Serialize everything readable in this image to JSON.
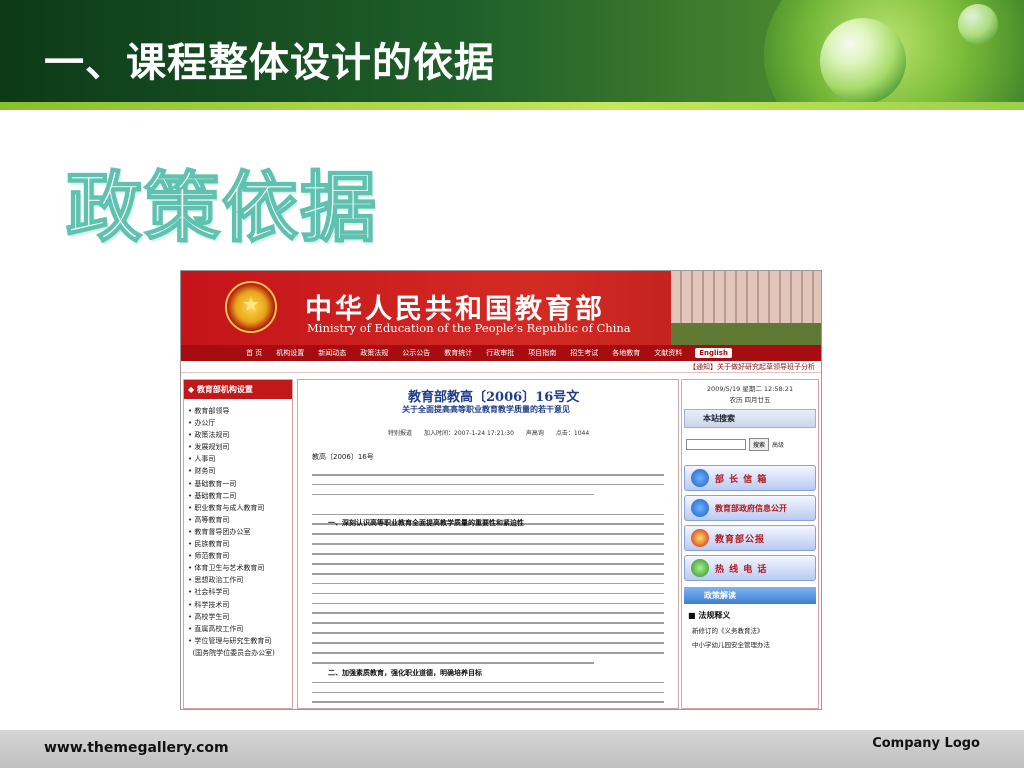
{
  "slide": {
    "title": "一、课程整体设计的依据",
    "subtitle": "政策依据"
  },
  "site": {
    "name_cn": "中华人民共和国教育部",
    "name_en": "Ministry of Education of the People’s Republic of China",
    "nav": [
      "首 页",
      "机构设置",
      "新闻动态",
      "政策法规",
      "公示公告",
      "教育统计",
      "行政审批",
      "项目指南",
      "招生考试",
      "各地教育",
      "文献资料"
    ],
    "english_button": "English",
    "notice": "【通知】关于做好研究起草领导班子分析"
  },
  "left_panel": {
    "heading": "◆ 教育部机构设置",
    "items": [
      "教育部领导",
      "办公厅",
      "政策法规司",
      "发展规划司",
      "人事司",
      "财务司",
      "基础教育一司",
      "基础教育二司",
      "职业教育与成人教育司",
      "高等教育司",
      "教育督导团办公室",
      "民族教育司",
      "师范教育司",
      "体育卫生与艺术教育司",
      "思想政治工作司",
      "社会科学司",
      "科学技术司",
      "高校学生司",
      "直属高校工作司",
      "学位管理与研究生教育司",
      "(国务院学位委员会办公室)"
    ]
  },
  "article": {
    "doc_number": "教育部教高〔2006〕16号文",
    "doc_title": "关于全面提高高等职业教育教学质量的若干意见",
    "meta": "特别报道　　加入时间：2007-1-24 17:21:30　　声高询　　点击：1044",
    "ref": "教高〔2006〕16号",
    "section1": "一、深刻认识高等职业教育全面提高教学质量的重要性和紧迫性",
    "section2": "二、加强素质教育，强化职业道德，明确培养目标"
  },
  "right_panel": {
    "datetime": "2009/5/19 星期二 12:58:21",
    "lunar": "农历 四月廿五",
    "search_title": "本站搜索",
    "search_button": "搜索",
    "advanced": "高级",
    "buttons": [
      "部 长 信 箱",
      "教育部政府信息公开",
      "教育部公报",
      "热 线 电 话"
    ],
    "law_head": "政策解读",
    "law_title": "■ 法规释义",
    "law_items": [
      "新修订的《义务教育法》",
      "中小学幼儿园安全管理办法"
    ]
  },
  "footer": {
    "website": "www.themegallery.com",
    "company_logo": "Company Logo"
  }
}
